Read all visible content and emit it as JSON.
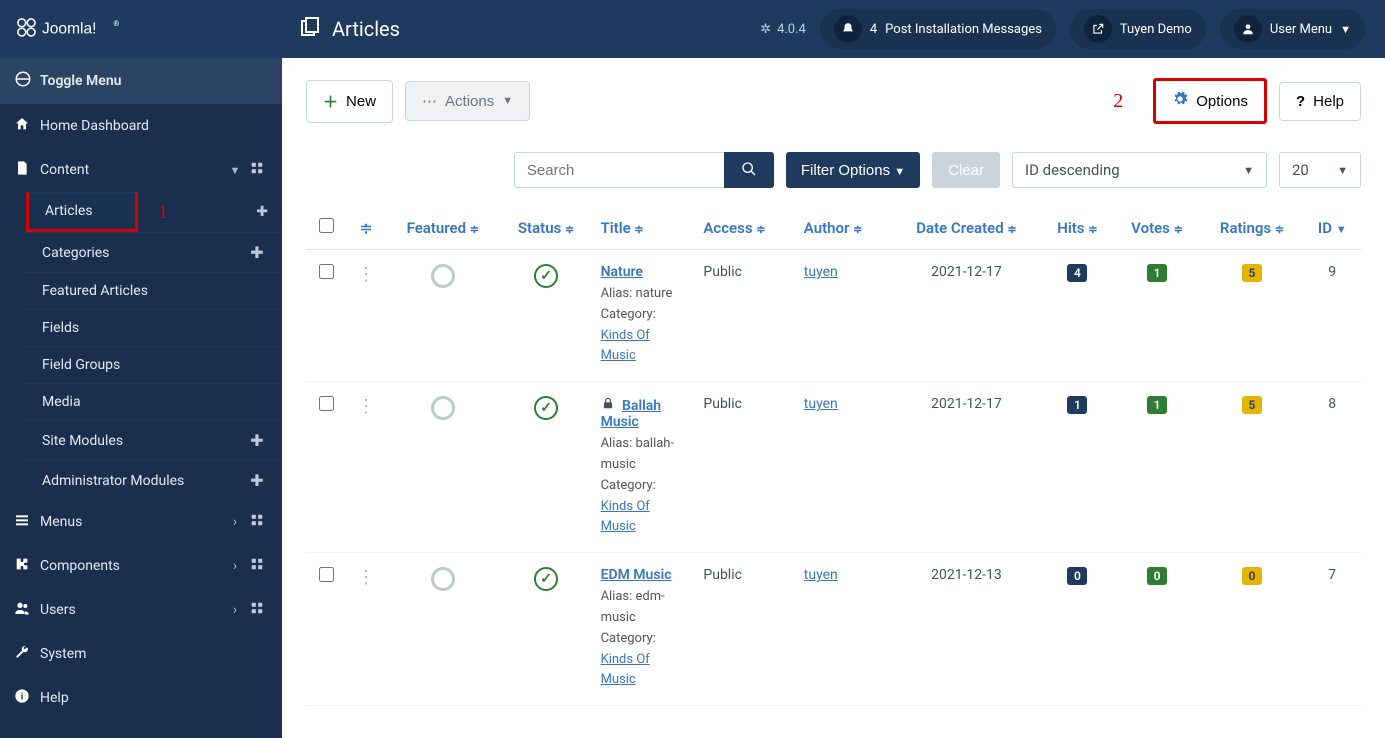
{
  "top": {
    "brand": "Joomla!",
    "page_icon": "copy-icon",
    "page_title": "Articles",
    "version": "4.0.4",
    "notif_count": "4",
    "post_install": "Post Installation Messages",
    "site_name": "Tuyen Demo",
    "user_menu": "User Menu"
  },
  "sidebar": {
    "toggle": "Toggle Menu",
    "items": [
      {
        "icon": "home",
        "label": "Home Dashboard",
        "chev": false,
        "grid": false
      },
      {
        "icon": "file",
        "label": "Content",
        "chev": true,
        "grid": true,
        "children": [
          {
            "label": "Articles",
            "plus": true,
            "active": true,
            "highlight": true
          },
          {
            "label": "Categories",
            "plus": true
          },
          {
            "label": "Featured Articles"
          },
          {
            "label": "Fields"
          },
          {
            "label": "Field Groups"
          },
          {
            "label": "Media"
          },
          {
            "label": "Site Modules",
            "plus": true
          },
          {
            "label": "Administrator Modules",
            "plus": true
          }
        ]
      },
      {
        "icon": "list",
        "label": "Menus",
        "chev": true,
        "grid": true
      },
      {
        "icon": "puzzle",
        "label": "Components",
        "chev": true,
        "grid": true
      },
      {
        "icon": "users",
        "label": "Users",
        "chev": true,
        "grid": true
      },
      {
        "icon": "wrench",
        "label": "System"
      },
      {
        "icon": "info",
        "label": "Help"
      }
    ]
  },
  "toolbar": {
    "new": "New",
    "actions": "Actions",
    "options": "Options",
    "help": "Help"
  },
  "annot": {
    "one": "1",
    "two": "2"
  },
  "filter": {
    "search_placeholder": "Search",
    "filter_options": "Filter Options",
    "clear": "Clear",
    "sort": "ID descending",
    "limit": "20"
  },
  "columns": {
    "featured": "Featured",
    "status": "Status",
    "title": "Title",
    "access": "Access",
    "author": "Author",
    "date": "Date Created",
    "hits": "Hits",
    "votes": "Votes",
    "ratings": "Ratings",
    "id": "ID"
  },
  "meta_labels": {
    "alias": "Alias: ",
    "category": "Category: "
  },
  "rows": [
    {
      "locked": false,
      "title": "Nature",
      "alias": "nature",
      "category": "Kinds Of Music",
      "access": "Public",
      "author": "tuyen",
      "date": "2021-12-17",
      "hits": "4",
      "votes": "1",
      "ratings": "5",
      "id": "9"
    },
    {
      "locked": true,
      "title": "Ballah Music",
      "alias": "ballah-music",
      "category": "Kinds Of Music",
      "access": "Public",
      "author": "tuyen",
      "date": "2021-12-17",
      "hits": "1",
      "votes": "1",
      "ratings": "5",
      "id": "8"
    },
    {
      "locked": false,
      "title": "EDM Music",
      "alias": "edm-music",
      "category": "Kinds Of Music",
      "access": "Public",
      "author": "tuyen",
      "date": "2021-12-13",
      "hits": "0",
      "votes": "0",
      "ratings": "0",
      "id": "7"
    }
  ]
}
